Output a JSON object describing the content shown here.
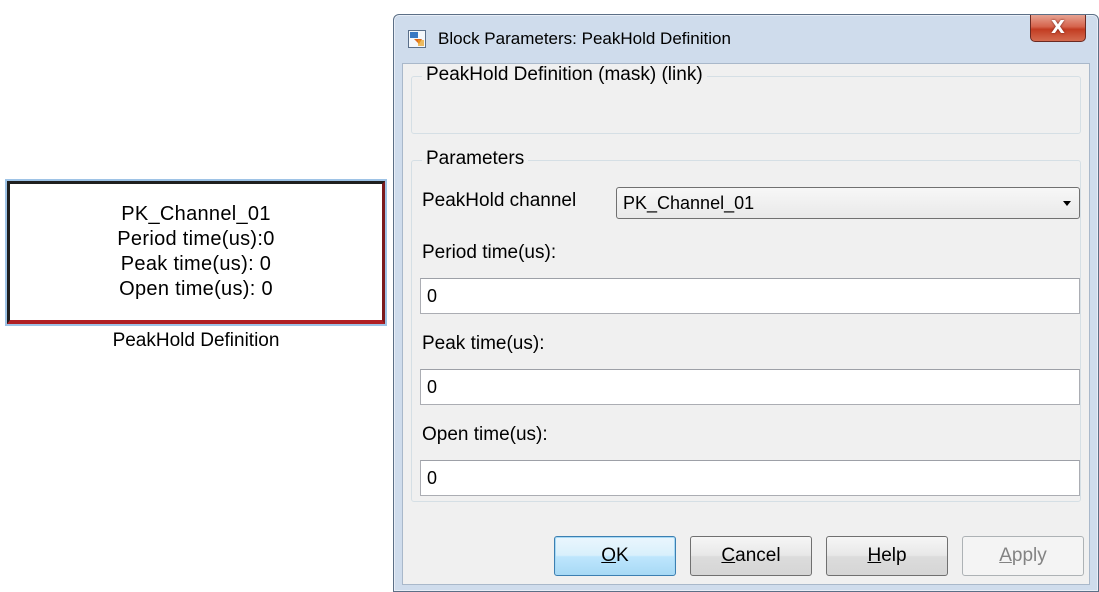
{
  "block": {
    "lines": [
      "PK_Channel_01",
      "Period time(us):0",
      "Peak time(us): 0",
      "Open time(us): 0"
    ],
    "caption": "PeakHold Definition"
  },
  "dialog": {
    "title": "Block Parameters: PeakHold Definition",
    "close_glyph": "X",
    "description_group": {
      "label": "PeakHold Definition (mask) (link)"
    },
    "parameters_group": {
      "label": "Parameters",
      "channel": {
        "label": "PeakHold channel",
        "selected": "PK_Channel_01"
      },
      "period": {
        "label": "Period time(us):",
        "value": "0"
      },
      "peak": {
        "label": "Peak time(us):",
        "value": "0"
      },
      "open": {
        "label": "Open time(us):",
        "value": "0"
      }
    },
    "buttons": {
      "ok": {
        "mnemonic": "O",
        "rest": "K"
      },
      "cancel": {
        "mnemonic": "C",
        "rest": "ancel"
      },
      "help": {
        "mnemonic": "H",
        "rest": "elp"
      },
      "apply": {
        "mnemonic": "A",
        "rest": "pply"
      }
    }
  },
  "colors": {
    "dialog_frame": "#cfdcec",
    "client_bg": "#f0f0f0",
    "close_button": "#c23c22",
    "block_border_bottom": "#b02025",
    "block_selection_glow": "#9ec3e6"
  },
  "icons": {
    "app_icon": "simulink-block-icon",
    "close": "close-icon",
    "dropdown": "chevron-down-icon"
  }
}
